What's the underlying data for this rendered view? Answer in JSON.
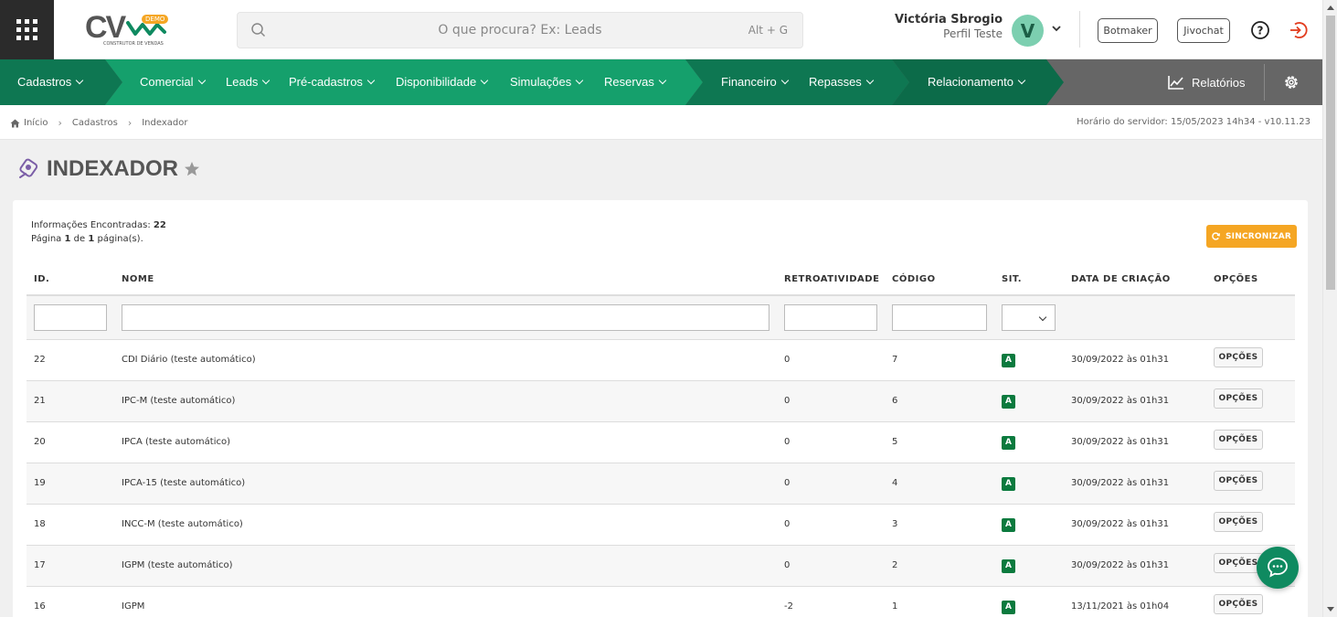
{
  "header": {
    "logo_text": "CV",
    "logo_badge": "DEMO",
    "logo_subtitle": "CONSTRUTOR DE VENDAS",
    "search_placeholder": "O que procura? Ex: Leads",
    "search_shortcut": "Alt + G",
    "user_name": "Victória Sbrogio",
    "user_role": "Perfil Teste",
    "avatar_letter": "V",
    "botmaker_label": "Botmaker",
    "jivochat_label": "Jivochat"
  },
  "nav": {
    "items": [
      "Cadastros",
      "Comercial",
      "Leads",
      "Pré-cadastros",
      "Disponibilidade",
      "Simulações",
      "Reservas",
      "Financeiro",
      "Repasses",
      "Relacionamento"
    ],
    "reports_label": "Relatórios",
    "colors": {
      "dark": "#0e7752",
      "mid": "#15a06c",
      "gray": "#666666"
    }
  },
  "breadcrumb": {
    "items": [
      "Início",
      "Cadastros",
      "Indexador"
    ],
    "server_time": "Horário do servidor: 15/05/2023 14h34 - v10.11.23"
  },
  "page": {
    "title": "INDEXADOR",
    "found_label": "Informações Encontradas:",
    "found_count": "22",
    "page_prefix": "Página",
    "page_current": "1",
    "page_mid": "de",
    "page_total": "1",
    "page_suffix": "página(s).",
    "sync_label": "SINCRONIZAR"
  },
  "table": {
    "headers": [
      "ID.",
      "NOME",
      "RETROATIVIDADE",
      "CÓDIGO",
      "SIT.",
      "DATA DE CRIAÇÃO",
      "OPÇÕES"
    ],
    "option_label": "OPÇÕES",
    "rows": [
      {
        "id": "22",
        "name": "CDI Diário (teste automático)",
        "retro": "0",
        "code": "7",
        "sit": "A",
        "date": "30/09/2022 às 01h31"
      },
      {
        "id": "21",
        "name": "IPC-M (teste automático)",
        "retro": "0",
        "code": "6",
        "sit": "A",
        "date": "30/09/2022 às 01h31"
      },
      {
        "id": "20",
        "name": "IPCA (teste automático)",
        "retro": "0",
        "code": "5",
        "sit": "A",
        "date": "30/09/2022 às 01h31"
      },
      {
        "id": "19",
        "name": "IPCA-15 (teste automático)",
        "retro": "0",
        "code": "4",
        "sit": "A",
        "date": "30/09/2022 às 01h31"
      },
      {
        "id": "18",
        "name": "INCC-M (teste automático)",
        "retro": "0",
        "code": "3",
        "sit": "A",
        "date": "30/09/2022 às 01h31"
      },
      {
        "id": "17",
        "name": "IGPM (teste automático)",
        "retro": "0",
        "code": "2",
        "sit": "A",
        "date": "30/09/2022 às 01h31"
      },
      {
        "id": "16",
        "name": "IGPM",
        "retro": "-2",
        "code": "1",
        "sit": "A",
        "date": "13/11/2021 às 01h04"
      }
    ]
  }
}
